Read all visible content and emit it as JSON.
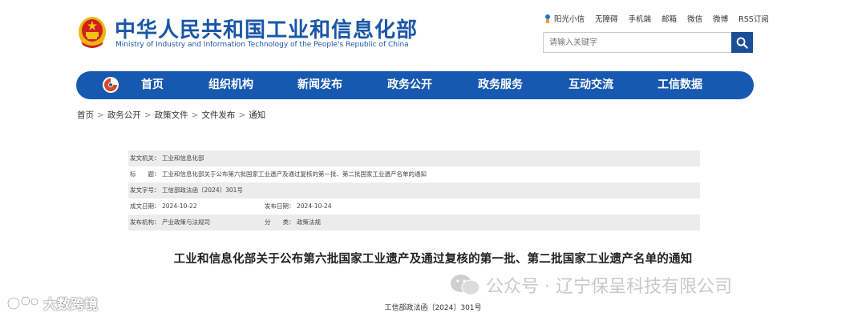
{
  "header": {
    "site_name_cn": "中华人民共和国工业和信息化部",
    "site_name_en": "Ministry of Industry and Information Technology of the People's Republic of China",
    "toplinks": [
      "阳光小信",
      "无障碍",
      "手机端",
      "邮箱",
      "微信",
      "微博",
      "RSS订阅"
    ],
    "search_placeholder": "请输入关键字"
  },
  "nav": {
    "items": [
      "首页",
      "组织机构",
      "新闻发布",
      "政务公开",
      "政务服务",
      "互动交流",
      "工信数据"
    ]
  },
  "breadcrumb": [
    "首页",
    "政务公开",
    "政策文件",
    "文件发布",
    "通知"
  ],
  "info": {
    "issuer_label": "发文机关：",
    "issuer_value": "工业和信息化部",
    "title_label": "标　　题：",
    "title_value": "工业和信息化部关于公布第六批国家工业遗产及通过复核的第一批、第二批国家工业遗产名单的通知",
    "docno_label": "发文字号：",
    "docno_value": "工信部政法函〔2024〕301号",
    "created_label": "成文日期：",
    "created_value": "2024-10-22",
    "published_label": "发布日期：",
    "published_value": "2024-10-24",
    "org_label": "发布机构：",
    "org_value": "产业政策与法规司",
    "category_label": "分　　类：",
    "category_value": "政策法规"
  },
  "document": {
    "title": "工业和信息化部关于公布第六批国家工业遗产及通过复核的第一批、第二批国家工业遗产名单的通知",
    "number": "工信部政法函〔2024〕301号"
  },
  "watermarks": {
    "left": "大数跨境",
    "right": "公众号 · 辽宁保呈科技有限公司"
  },
  "colors": {
    "brand_blue": "#1758b0",
    "emblem_red": "#d0201b",
    "emblem_gold": "#f3c11a"
  }
}
